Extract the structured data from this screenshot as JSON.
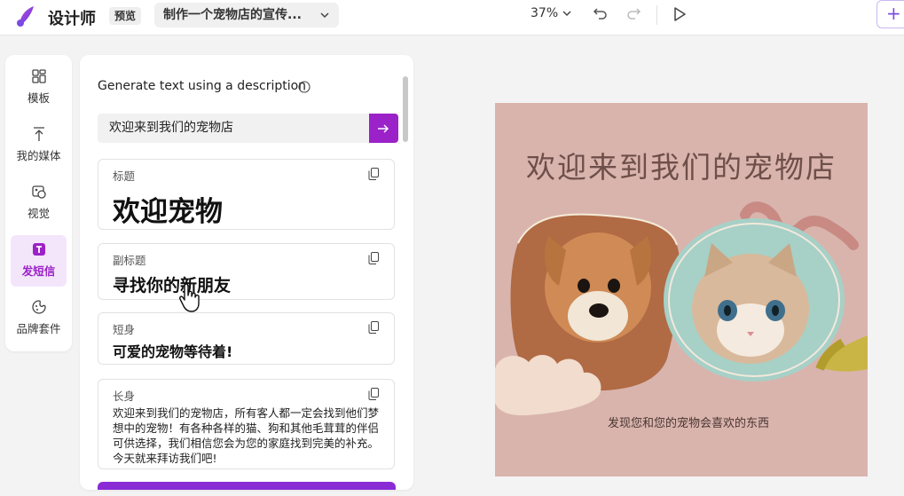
{
  "header": {
    "app_title": "设计师",
    "preview_label": "预览",
    "doc_title": "制作一个宠物店的宣传...",
    "zoom": "37%",
    "add_label": "+"
  },
  "nav": {
    "items": [
      {
        "label": "模板",
        "icon": "grid-icon"
      },
      {
        "label": "我的媒体",
        "icon": "upload-icon"
      },
      {
        "label": "视觉",
        "icon": "visual-icon"
      },
      {
        "label": "发短信",
        "icon": "text-icon",
        "active": true
      },
      {
        "label": "品牌套件",
        "icon": "brand-kit-icon"
      }
    ]
  },
  "panel": {
    "heading": "Generate text using a description",
    "prompt_value": "欢迎来到我们的宠物店",
    "cards": [
      {
        "label": "标题",
        "text": "欢迎宠物"
      },
      {
        "label": "副标题",
        "text": "寻找你的新朋友"
      },
      {
        "label": "短身",
        "text": "可爱的宠物等待着!"
      },
      {
        "label": "长身",
        "text": "欢迎来到我们的宠物店，所有客人都一定会找到他们梦想中的宠物！有各种各样的猫、狗和其他毛茸茸的伴侣可供选择，我们相信您会为您的家庭找到完美的补充。今天就来拜访我们吧!"
      }
    ]
  },
  "design": {
    "title": "欢迎来到我们的宠物店",
    "subtitle": "发现您和您的宠物会喜欢的东西"
  },
  "colors": {
    "accent": "#9b22c8",
    "design_bg": "#d9b4ad",
    "design_text": "#6e4f4a"
  }
}
